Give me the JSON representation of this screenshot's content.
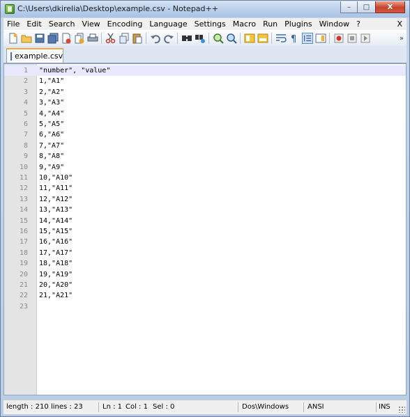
{
  "window": {
    "title": "C:\\Users\\dkirelia\\Desktop\\example.csv - Notepad++",
    "minimize": "–",
    "maximize": "□",
    "close": "X"
  },
  "menu": [
    "File",
    "Edit",
    "Search",
    "View",
    "Encoding",
    "Language",
    "Settings",
    "Macro",
    "Run",
    "Plugins",
    "Window",
    "?"
  ],
  "menu_close": "X",
  "toolbar": {
    "icons": [
      "new-file-icon",
      "open-file-icon",
      "save-icon",
      "save-all-icon",
      "close-file-icon",
      "close-all-icon",
      "print-icon",
      "cut-icon",
      "copy-icon",
      "paste-icon",
      "undo-icon",
      "redo-icon",
      "find-icon",
      "replace-icon",
      "zoom-in-icon",
      "zoom-out-icon",
      "sync-vertical-icon",
      "sync-horizontal-icon",
      "word-wrap-icon",
      "show-all-chars-icon",
      "indent-guide-icon",
      "doc-map-icon",
      "record-macro-icon",
      "stop-record-icon",
      "play-macro-icon"
    ],
    "more": "»"
  },
  "tabs": [
    {
      "label": "example.csv"
    }
  ],
  "editor": {
    "current_line": 1,
    "lines": [
      "\"number\", \"value\"",
      "1,\"A1\"",
      "2,\"A2\"",
      "3,\"A3\"",
      "4,\"A4\"",
      "5,\"A5\"",
      "6,\"A6\"",
      "7,\"A7\"",
      "8,\"A8\"",
      "9,\"A9\"",
      "10,\"A10\"",
      "11,\"A11\"",
      "12,\"A12\"",
      "13,\"A13\"",
      "14,\"A14\"",
      "15,\"A15\"",
      "16,\"A16\"",
      "17,\"A17\"",
      "18,\"A18\"",
      "19,\"A19\"",
      "20,\"A20\"",
      "21,\"A21\"",
      ""
    ]
  },
  "status": {
    "length": "length : 210",
    "lines": "lines : 23",
    "ln": "Ln : 1",
    "col": "Col : 1",
    "sel": "Sel : 0",
    "eol": "Dos\\Windows",
    "encoding": "ANSI",
    "mode": "INS"
  },
  "colors": {
    "current_line": "#e8e8ff",
    "gutter": "#e4e4e4",
    "tab_accent": "#f2a93b"
  }
}
